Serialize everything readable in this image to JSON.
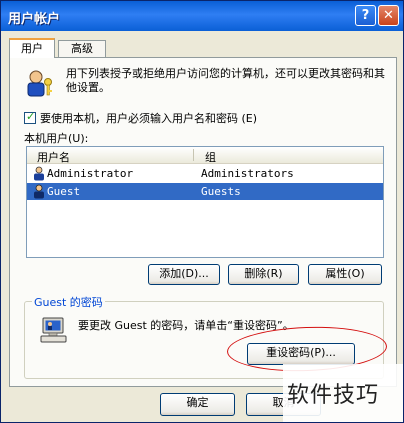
{
  "window": {
    "title": "用户帐户",
    "help_glyph": "?",
    "close_glyph": "✕"
  },
  "tabs": [
    {
      "label": "用户",
      "active": true
    },
    {
      "label": "高级",
      "active": false
    }
  ],
  "intro_text": "用下列表授予或拒绝用户访问您的计算机，还可以更改其密码和其他设置。",
  "require_password": {
    "label": "要使用本机，用户必须输入用户名和密码 (E)",
    "checked": true
  },
  "local_users_label": "本机用户(U):",
  "list": {
    "columns": [
      "用户名",
      "组"
    ],
    "rows": [
      {
        "name": "Administrator",
        "group": "Administrators",
        "selected": false
      },
      {
        "name": "Guest",
        "group": "Guests",
        "selected": true
      }
    ]
  },
  "buttons": {
    "add": "添加(D)...",
    "remove": "删除(R)",
    "properties": "属性(O)"
  },
  "password_section": {
    "title": "Guest 的密码",
    "text": "要更改 Guest 的密码，请单击“重设密码”。",
    "reset_button": "重设密码(P)..."
  },
  "footer": {
    "ok": "确定",
    "cancel": "取消"
  },
  "watermark": "软件技巧",
  "colors": {
    "titlebar": "#0a5fd6",
    "selection": "#316ac5",
    "annotation": "#d41010",
    "dialog_bg": "#ece9d8"
  }
}
